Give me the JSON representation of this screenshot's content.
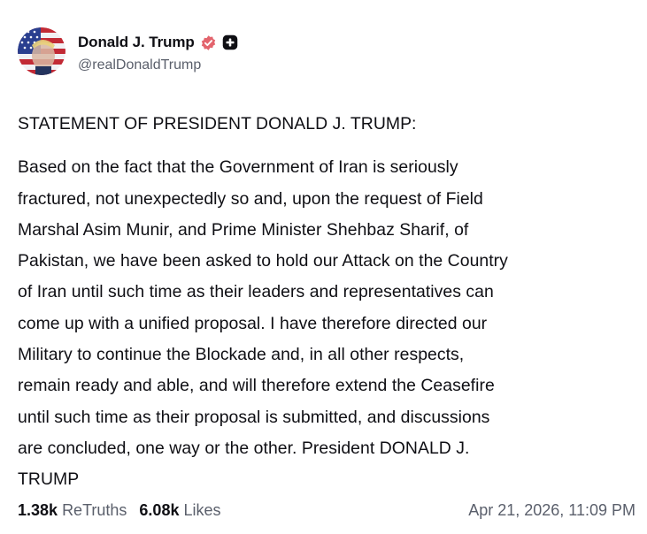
{
  "author": {
    "display_name": "Donald J. Trump",
    "handle": "@realDonaldTrump",
    "avatar_icon": "profile-photo-flag-icon",
    "verified_icon": "verified-badge-icon",
    "verified_color": "#e3646d",
    "extra_badge_icon": "plus-badge-icon"
  },
  "post": {
    "title": "STATEMENT OF PRESIDENT DONALD J. TRUMP:",
    "lines": [
      "Based on the fact that the Government of Iran is seriously",
      "fractured, not unexpectedly so and, upon the request of Field",
      "Marshal Asim Munir, and Prime Minister Shehbaz Sharif, of",
      "Pakistan, we have been asked to hold our Attack on the Country",
      "of Iran until such time as their leaders and representatives can",
      "come up with a unified proposal. I have therefore directed our",
      "Military to continue the Blockade and, in all other respects,",
      "remain ready and able, and will therefore extend the Ceasefire",
      "until such time as their proposal is submitted, and discussions",
      "are concluded, one way or the other. President DONALD J.",
      "TRUMP"
    ]
  },
  "stats": {
    "retruths_count": "1.38k",
    "retruths_label": "ReTruths",
    "likes_count": "6.08k",
    "likes_label": "Likes"
  },
  "timestamp": "Apr 21, 2026, 11:09 PM"
}
